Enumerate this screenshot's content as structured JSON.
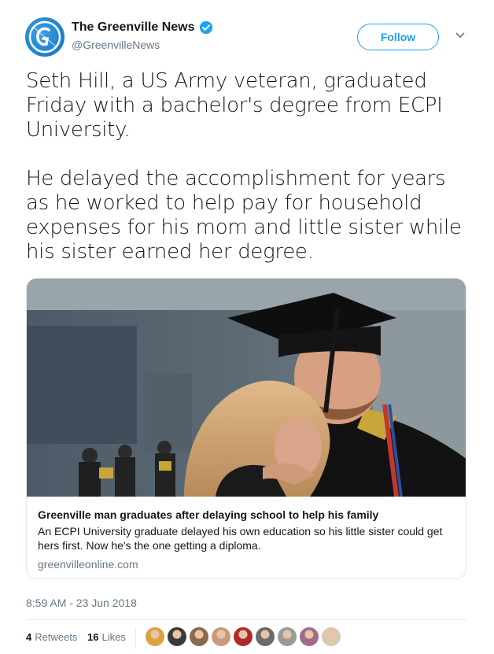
{
  "author": {
    "display_name": "The Greenville News",
    "handle": "@GreenvilleNews",
    "avatar_icon": "newspaper-g-logo",
    "verified_icon": "verified-badge-icon",
    "accent_color": "#1da1f2"
  },
  "actions": {
    "follow_label": "Follow",
    "more_icon": "chevron-down-icon"
  },
  "tweet": {
    "paragraph_1": "Seth Hill, a US Army veteran, graduated Friday with a bachelor's degree from ECPI University.",
    "paragraph_2": "He delayed the accomplishment for years as he worked to help pay for household expenses for his mom and little sister while his sister earned her degree."
  },
  "card": {
    "title": "Greenville man graduates after delaying school to help his family",
    "description": "An ECPI University graduate delayed his own education so his little sister could get hers first. Now he's the one getting a diploma.",
    "domain": "greenvilleonline.com"
  },
  "timestamp": "8:59 AM - 23 Jun 2018",
  "stats": {
    "retweets_count": "4",
    "retweets_label": "Retweets",
    "likes_count": "16",
    "likes_label": "Likes"
  },
  "likers": [
    {
      "color": "#d9a441"
    },
    {
      "color": "#3b3b3b"
    },
    {
      "color": "#8a6a4f"
    },
    {
      "color": "#c99a7a"
    },
    {
      "color": "#b02a2a"
    },
    {
      "color": "#6b6b6b"
    },
    {
      "color": "#9a9a9a"
    },
    {
      "color": "#a06b8a"
    },
    {
      "color": "#d8c9b0"
    }
  ]
}
